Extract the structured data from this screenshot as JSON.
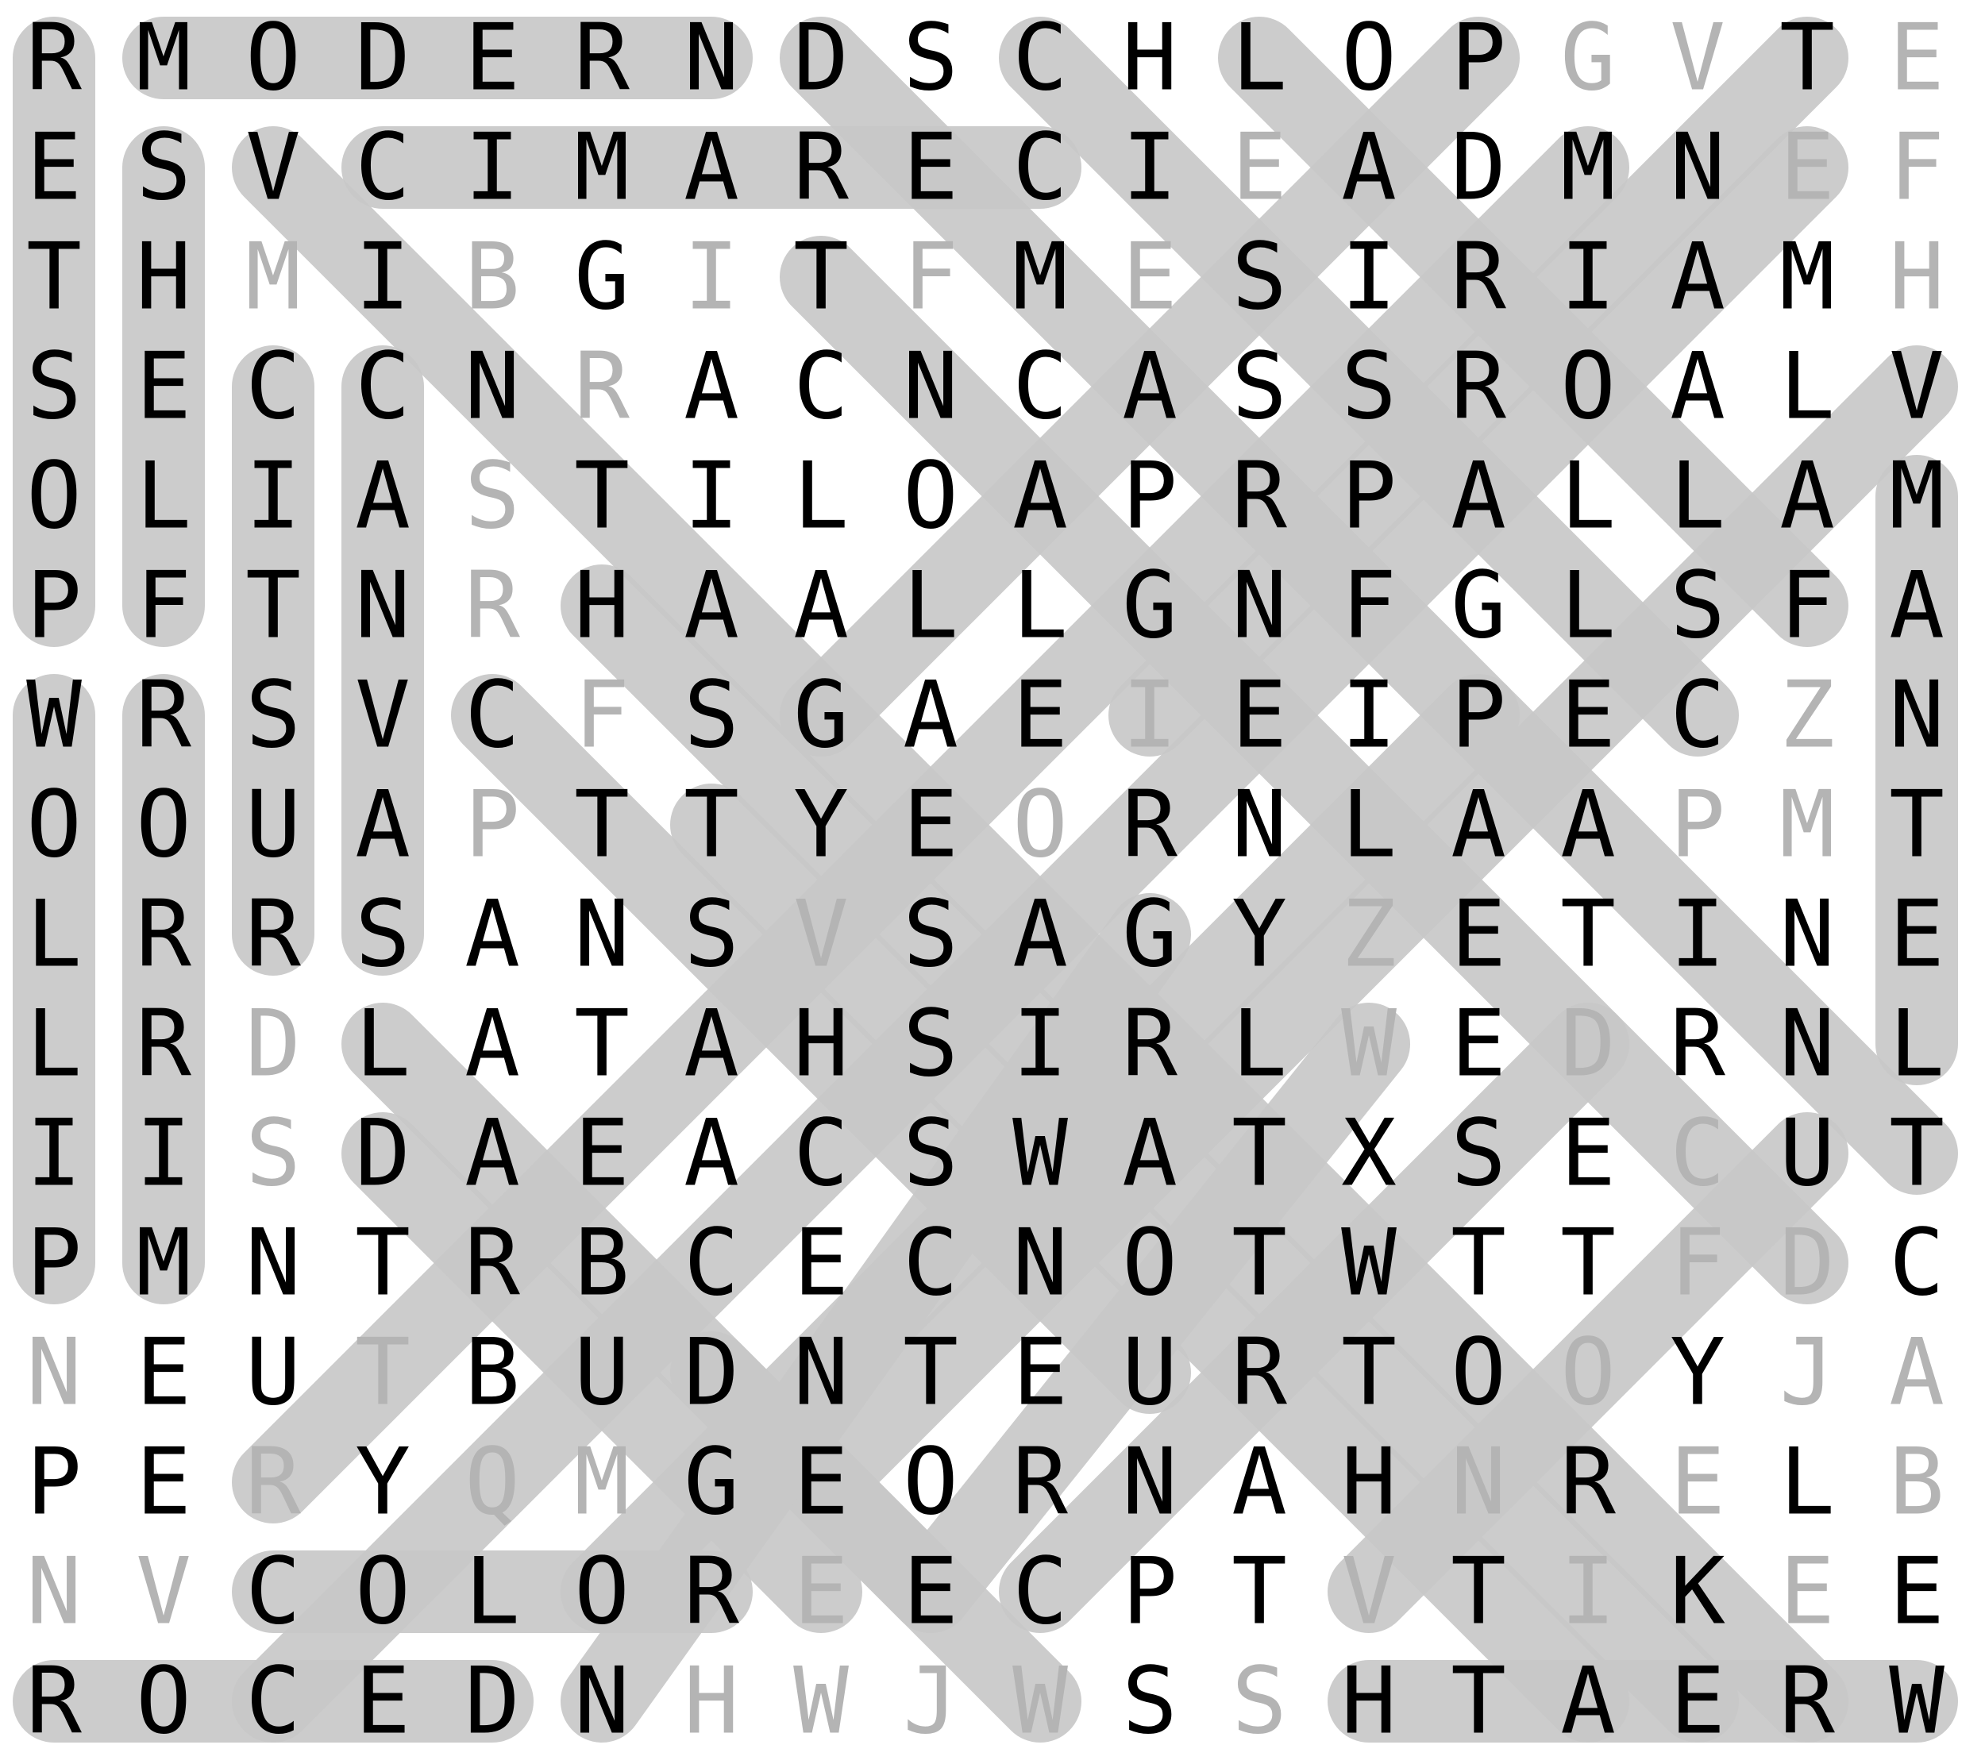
{
  "puzzle": {
    "rows": [
      "RMODERNDSCHLOPGVTE",
      "ESVCIMARECIEADMNEF",
      "THMIBGITFMESIRIAMH",
      "SECCNRACNCASSROALV",
      "OLIASTILOAPRPALLAM",
      "PFTNRHAALLGNFGLSFA",
      "WRSVCFSGAEIEIPECZN",
      "OOUAPTTYEORNLAAPMT",
      "LRRSANSVSAGYZETINE",
      "LRDLATAHSIRLWEDRNL",
      "IISDAEACSWATXSECUT",
      "PMNTRBCECNOTWTTFDC",
      "NEUTBUDNTEURTOOYJA",
      "PERYQMGEORNAHNRELB",
      "NVCOLOREECPTVTIKEE",
      "ROCEDNHWJWSSHTAERW"
    ],
    "used_cells": [
      [
        1,
        1,
        1,
        1,
        1,
        1,
        1,
        1,
        1,
        1,
        1,
        1,
        1,
        1,
        0,
        0,
        1,
        0
      ],
      [
        1,
        1,
        1,
        1,
        1,
        1,
        1,
        1,
        1,
        1,
        1,
        0,
        1,
        1,
        1,
        1,
        0,
        0
      ],
      [
        1,
        1,
        0,
        1,
        0,
        1,
        0,
        1,
        0,
        1,
        0,
        1,
        1,
        1,
        1,
        1,
        1,
        0
      ],
      [
        1,
        1,
        1,
        1,
        1,
        0,
        1,
        1,
        1,
        1,
        1,
        1,
        1,
        1,
        1,
        1,
        1,
        1
      ],
      [
        1,
        1,
        1,
        1,
        0,
        1,
        1,
        1,
        1,
        1,
        1,
        1,
        1,
        1,
        1,
        1,
        1,
        1
      ],
      [
        1,
        1,
        1,
        1,
        0,
        1,
        1,
        1,
        1,
        1,
        1,
        1,
        1,
        1,
        1,
        1,
        1,
        1
      ],
      [
        1,
        1,
        1,
        1,
        1,
        0,
        1,
        1,
        1,
        1,
        0,
        1,
        1,
        1,
        1,
        1,
        0,
        1
      ],
      [
        1,
        1,
        1,
        1,
        0,
        1,
        1,
        1,
        1,
        0,
        1,
        1,
        1,
        1,
        1,
        0,
        0,
        1
      ],
      [
        1,
        1,
        1,
        1,
        1,
        1,
        1,
        0,
        1,
        1,
        1,
        1,
        0,
        1,
        1,
        1,
        1,
        1
      ],
      [
        1,
        1,
        0,
        1,
        1,
        1,
        1,
        1,
        1,
        1,
        1,
        1,
        0,
        1,
        0,
        1,
        1,
        1
      ],
      [
        1,
        1,
        0,
        1,
        1,
        1,
        1,
        1,
        1,
        1,
        1,
        1,
        1,
        1,
        1,
        0,
        1,
        1
      ],
      [
        1,
        1,
        1,
        1,
        1,
        1,
        1,
        1,
        1,
        1,
        1,
        1,
        1,
        1,
        1,
        0,
        0,
        1
      ],
      [
        0,
        1,
        1,
        0,
        1,
        1,
        1,
        1,
        1,
        1,
        1,
        1,
        1,
        1,
        0,
        1,
        0,
        0
      ],
      [
        1,
        1,
        0,
        1,
        0,
        0,
        1,
        1,
        1,
        1,
        1,
        1,
        1,
        0,
        1,
        0,
        1,
        0
      ],
      [
        0,
        0,
        1,
        1,
        1,
        1,
        1,
        0,
        1,
        1,
        1,
        1,
        0,
        1,
        0,
        1,
        0,
        1
      ],
      [
        1,
        1,
        1,
        1,
        1,
        1,
        0,
        0,
        0,
        0,
        1,
        0,
        1,
        1,
        1,
        1,
        1,
        1
      ]
    ],
    "highlights": [
      {
        "from": [
          0,
          1
        ],
        "to": [
          0,
          6
        ]
      },
      {
        "from": [
          1,
          3
        ],
        "to": [
          1,
          9
        ]
      },
      {
        "from": [
          0,
          0
        ],
        "to": [
          5,
          0
        ]
      },
      {
        "from": [
          1,
          1
        ],
        "to": [
          5,
          1
        ]
      },
      {
        "from": [
          6,
          0
        ],
        "to": [
          11,
          0
        ]
      },
      {
        "from": [
          6,
          1
        ],
        "to": [
          11,
          1
        ]
      },
      {
        "from": [
          3,
          2
        ],
        "to": [
          8,
          2
        ]
      },
      {
        "from": [
          3,
          3
        ],
        "to": [
          8,
          3
        ]
      },
      {
        "from": [
          4,
          17
        ],
        "to": [
          9,
          17
        ]
      },
      {
        "from": [
          14,
          2
        ],
        "to": [
          14,
          6
        ]
      },
      {
        "from": [
          15,
          0
        ],
        "to": [
          15,
          4
        ]
      },
      {
        "from": [
          15,
          12
        ],
        "to": [
          15,
          17
        ]
      },
      {
        "from": [
          1,
          2
        ],
        "to": [
          15,
          16
        ]
      },
      {
        "from": [
          0,
          7
        ],
        "to": [
          10,
          17
        ]
      },
      {
        "from": [
          0,
          9
        ],
        "to": [
          6,
          15
        ]
      },
      {
        "from": [
          0,
          11
        ],
        "to": [
          5,
          16
        ]
      },
      {
        "from": [
          2,
          7
        ],
        "to": [
          11,
          16
        ]
      },
      {
        "from": [
          5,
          5
        ],
        "to": [
          15,
          15
        ]
      },
      {
        "from": [
          7,
          6
        ],
        "to": [
          15,
          14
        ]
      },
      {
        "from": [
          9,
          3
        ],
        "to": [
          15,
          9
        ]
      },
      {
        "from": [
          10,
          3
        ],
        "to": [
          14,
          7
        ]
      },
      {
        "from": [
          12,
          6
        ],
        "to": [
          14,
          8
        ]
      },
      {
        "from": [
          0,
          13
        ],
        "to": [
          6,
          7
        ]
      },
      {
        "from": [
          0,
          16
        ],
        "to": [
          6,
          10
        ]
      },
      {
        "from": [
          1,
          14
        ],
        "to": [
          13,
          2
        ]
      },
      {
        "from": [
          3,
          17
        ],
        "to": [
          13,
          7
        ]
      },
      {
        "from": [
          1,
          16
        ],
        "to": [
          15,
          2
        ]
      },
      {
        "from": [
          6,
          4
        ],
        "to": [
          12,
          10
        ]
      },
      {
        "from": [
          8,
          10
        ],
        "to": [
          15,
          5
        ]
      },
      {
        "from": [
          6,
          13
        ],
        "to": [
          14,
          5
        ]
      },
      {
        "from": [
          9,
          14
        ],
        "to": [
          14,
          9
        ]
      },
      {
        "from": [
          10,
          16
        ],
        "to": [
          14,
          12
        ]
      },
      {
        "from": [
          9,
          12
        ],
        "to": [
          14,
          8
        ]
      }
    ],
    "colors": {
      "highlight": "#c8c8c8",
      "letter_found": "#000000",
      "letter_unused": "#b4b4b4"
    }
  }
}
